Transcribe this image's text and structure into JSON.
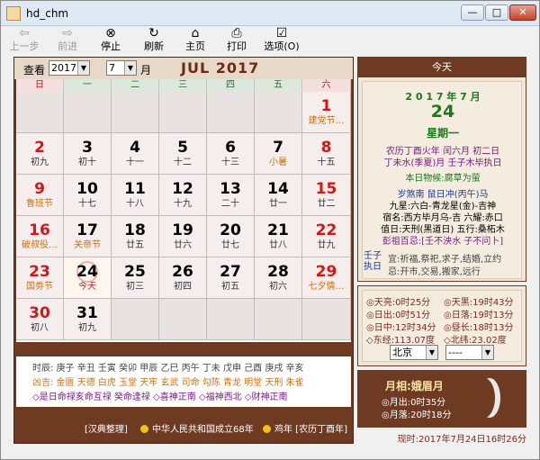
{
  "window": {
    "title": "hd_chm"
  },
  "toolbar": [
    {
      "label": "上一步",
      "icon": "back-arrow-icon",
      "disabled": true
    },
    {
      "label": "前进",
      "icon": "forward-arrow-icon",
      "disabled": true
    },
    {
      "label": "停止",
      "icon": "stop-icon",
      "disabled": false
    },
    {
      "label": "刷新",
      "icon": "refresh-icon",
      "disabled": false
    },
    {
      "label": "主页",
      "icon": "home-icon",
      "disabled": false
    },
    {
      "label": "打印",
      "icon": "print-icon",
      "disabled": false
    },
    {
      "label": "选项(O)",
      "icon": "options-icon",
      "disabled": false
    }
  ],
  "calendar": {
    "view_label": "查看",
    "year_value": "2017",
    "month_value": "7",
    "month_suffix": "月",
    "title": "JUL 2017",
    "weekdays": [
      "日",
      "一",
      "二",
      "三",
      "四",
      "五",
      "六"
    ],
    "cells": [
      {
        "d": "",
        "l": ""
      },
      {
        "d": "",
        "l": ""
      },
      {
        "d": "",
        "l": ""
      },
      {
        "d": "",
        "l": ""
      },
      {
        "d": "",
        "l": ""
      },
      {
        "d": "",
        "l": ""
      },
      {
        "d": "1",
        "l": "建党节…",
        "hol": true
      },
      {
        "d": "2",
        "l": "初九"
      },
      {
        "d": "3",
        "l": "初十"
      },
      {
        "d": "4",
        "l": "十一"
      },
      {
        "d": "5",
        "l": "十二"
      },
      {
        "d": "6",
        "l": "十三"
      },
      {
        "d": "7",
        "l": "小暑",
        "hol": true
      },
      {
        "d": "8",
        "l": "十五"
      },
      {
        "d": "9",
        "l": "鲁班节",
        "hol": true
      },
      {
        "d": "10",
        "l": "十七"
      },
      {
        "d": "11",
        "l": "十八"
      },
      {
        "d": "12",
        "l": "十九"
      },
      {
        "d": "13",
        "l": "二十"
      },
      {
        "d": "14",
        "l": "廿一"
      },
      {
        "d": "15",
        "l": "廿二"
      },
      {
        "d": "16",
        "l": "破叔役…",
        "hol": true
      },
      {
        "d": "17",
        "l": "关帝节",
        "hol": true
      },
      {
        "d": "18",
        "l": "廿五"
      },
      {
        "d": "19",
        "l": "廿六"
      },
      {
        "d": "20",
        "l": "廿七"
      },
      {
        "d": "21",
        "l": "廿八"
      },
      {
        "d": "22",
        "l": "廿九"
      },
      {
        "d": "23",
        "l": "国劵节",
        "hol": true
      },
      {
        "d": "24",
        "l": "今天",
        "today": true
      },
      {
        "d": "25",
        "l": "初三"
      },
      {
        "d": "26",
        "l": "初四"
      },
      {
        "d": "27",
        "l": "初五"
      },
      {
        "d": "28",
        "l": "初六"
      },
      {
        "d": "29",
        "l": "七夕情…",
        "hol": true
      },
      {
        "d": "30",
        "l": "初八"
      },
      {
        "d": "31",
        "l": "初九"
      },
      {
        "d": "",
        "l": ""
      },
      {
        "d": "",
        "l": ""
      },
      {
        "d": "",
        "l": ""
      },
      {
        "d": "",
        "l": ""
      },
      {
        "d": "",
        "l": ""
      }
    ],
    "info": {
      "shichen": "时辰: 庚子 辛丑 壬寅 癸卯 甲辰 乙巳 丙午 丁未 戊申 己酉 庚戌 辛亥",
      "jixiong": "凶吉: 金匮 天德 白虎 玉堂 天牢 玄武 司命 勾陈 青龙 明堂 天刑 朱雀",
      "extra": "◇是日命禄亥命互禄 癸命逢禄 ◇喜神正南 ◇福神西北 ◇财神正南"
    },
    "footer": {
      "left": "[汉典整理]",
      "middle": "中华人民共和国成立68年",
      "right": "鸡年 [农历丁酉年]"
    }
  },
  "today_panel": {
    "header": "今天",
    "ym": "2 0 1 7 年 7 月",
    "day": "24",
    "weekday": "星期一",
    "lunar1": "农历丁酉火年 闰六月 初二日",
    "lunar2": "丁未水(季夏)月 壬子木毕执日",
    "hou": "本日物候:腐草为萤",
    "sha": "岁煞南 鼠日冲(丙午)马",
    "x1": "九星:六白-青龙星(金)-吉神",
    "x2": "宿名:西方毕月乌-吉 六耀:赤口",
    "x3": "值日:天刑(黑道日) 五行:桑柘木",
    "x4": "彭祖百忌:[壬不泱水 子不问卜]",
    "side": "壬子执日",
    "yi": "宜:祈福,祭祀,求子,结婚,立约",
    "ji": "忌:开市,交易,搬家,远行"
  },
  "sun_panel": {
    "tianliang": "◎天亮:0时25分",
    "richu": "◎日出:0时51分",
    "rizhong": "◎日中:12时34分",
    "tianhei": "◎天黑:19时43分",
    "riluo": "◎日落:19时13分",
    "zhouchang": "◎昼长:18时13分",
    "dongjing": "◇东经:113.07度",
    "beiwei": "◇北纬:23.02度",
    "city": "北京",
    "district": "----"
  },
  "moon_panel": {
    "title": "月相:娥眉月",
    "moonrise": "◎月出:0时35分",
    "moonset": "◎月落:20时18分"
  },
  "status": {
    "now": "现时:2017年7月24日16时26分"
  }
}
